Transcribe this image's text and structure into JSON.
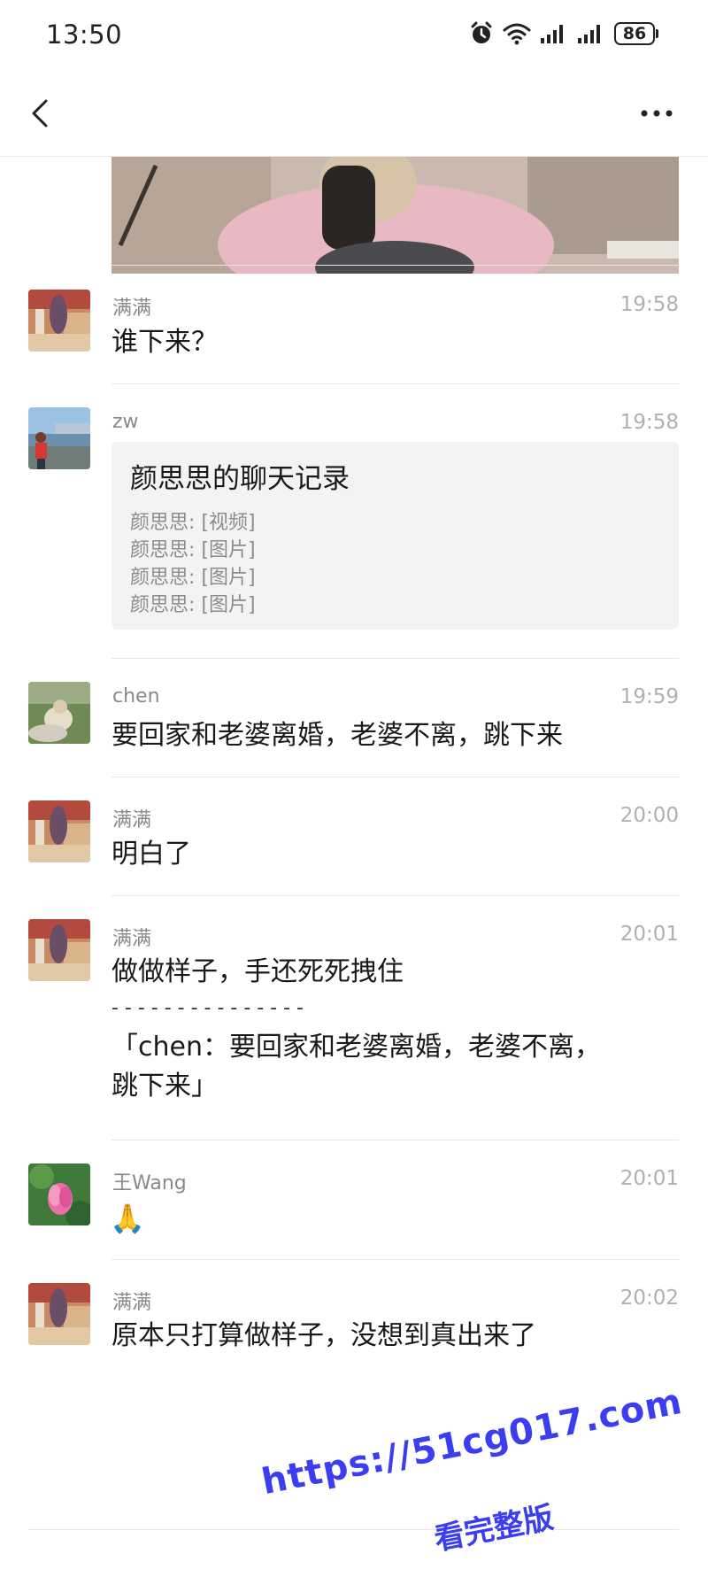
{
  "status_bar": {
    "time": "13:50",
    "battery": "86",
    "icons": [
      "alarm-icon",
      "wifi-icon",
      "signal-icon",
      "signal-icon"
    ]
  },
  "nav": {
    "back_icon": "chevron-left-icon",
    "more_icon": "ellipsis-icon"
  },
  "messages": [
    {
      "sender": "满满",
      "time": "19:58",
      "text": "谁下来？"
    },
    {
      "sender": "zw",
      "time": "19:58",
      "record": {
        "title": "颜思思的聊天记录",
        "lines": [
          "颜思思: [视频]",
          "颜思思: [图片]",
          "颜思思: [图片]",
          "颜思思: [图片]"
        ]
      }
    },
    {
      "sender": "chen",
      "time": "19:59",
      "text": "要回家和老婆离婚，老婆不离，跳下来"
    },
    {
      "sender": "满满",
      "time": "20:00",
      "text": "明白了"
    },
    {
      "sender": "满满",
      "time": "20:01",
      "text_lines": [
        "做做样子，手还死死拽住",
        "- - - - - - - - - - - - - - -",
        "「chen：要回家和老婆离婚，老婆不离，",
        "跳下来」"
      ]
    },
    {
      "sender": "王Wang",
      "time": "20:01",
      "emoji": "🙏"
    },
    {
      "sender": "满满",
      "time": "20:02",
      "text": "原本只打算做样子，没想到真出来了"
    }
  ],
  "watermark": {
    "url": "https://51cg017.com",
    "sub": "看完整版",
    "color": "#3a3df0"
  }
}
